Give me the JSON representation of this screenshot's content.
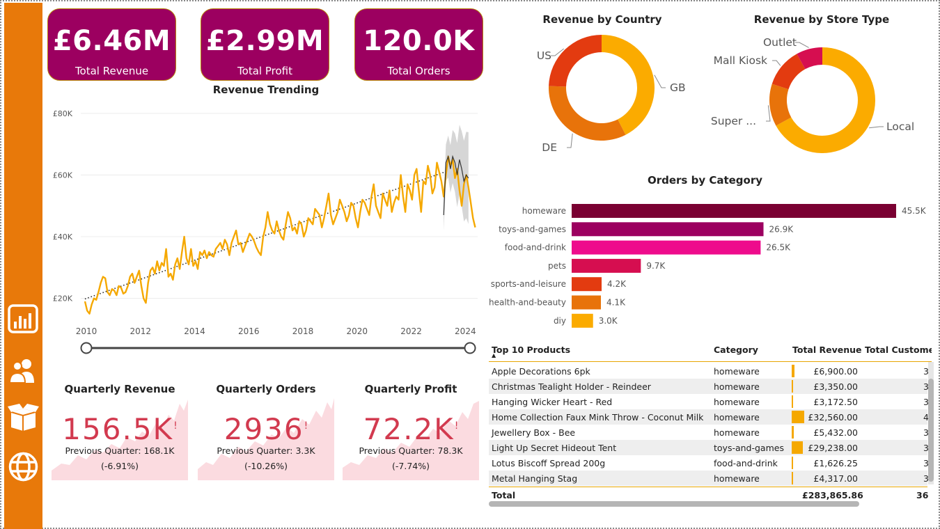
{
  "kpis": [
    {
      "value": "£6.46M",
      "label": "Total Revenue"
    },
    {
      "value": "£2.99M",
      "label": "Total Profit"
    },
    {
      "value": "120.0K",
      "label": "Total Orders"
    }
  ],
  "sidebar": {
    "items": [
      {
        "icon": "bar-chart-icon"
      },
      {
        "icon": "users-icon"
      },
      {
        "icon": "box-icon"
      },
      {
        "icon": "globe-icon"
      }
    ]
  },
  "quarterly": [
    {
      "title": "Quarterly Revenue",
      "value": "156.5K",
      "flag": "!",
      "previous": "Previous Quarter: 168.1K",
      "change": "(-6.91%)"
    },
    {
      "title": "Quarterly Orders",
      "value": "2936",
      "flag": "!",
      "previous": "Previous Quarter: 3.3K",
      "change": "(-10.26%)"
    },
    {
      "title": "Quarterly Profit",
      "value": "72.2K",
      "flag": "!",
      "previous": "Previous Quarter: 78.3K",
      "change": "(-7.74%)"
    }
  ],
  "table": {
    "headers": [
      "Top 10 Products",
      "Category",
      "Total Revenue",
      "Total Customers"
    ],
    "header_display": [
      "Top 10 Products",
      "Category",
      "Total Revenue",
      "Total Custome"
    ],
    "rows": [
      {
        "product": "Apple Decorations 6pk",
        "category": "homeware",
        "revenue": "£6,900.00",
        "revenue_num": 6900,
        "customers": "3"
      },
      {
        "product": "Christmas Tealight Holder - Reindeer",
        "category": "homeware",
        "revenue": "£3,350.00",
        "revenue_num": 3350,
        "customers": "3"
      },
      {
        "product": "Hanging Wicker Heart - Red",
        "category": "homeware",
        "revenue": "£3,172.50",
        "revenue_num": 3172.5,
        "customers": "3"
      },
      {
        "product": "Home Collection Faux Mink Throw - Coconut Milk",
        "category": "homeware",
        "revenue": "£32,560.00",
        "revenue_num": 32560,
        "customers": "4"
      },
      {
        "product": "Jewellery Box - Bee",
        "category": "homeware",
        "revenue": "£5,432.00",
        "revenue_num": 5432,
        "customers": "3"
      },
      {
        "product": "Light Up Secret Hideout Tent",
        "category": "toys-and-games",
        "revenue": "£29,238.00",
        "revenue_num": 29238,
        "customers": "3"
      },
      {
        "product": "Lotus Biscoff Spread 200g",
        "category": "food-and-drink",
        "revenue": "£1,626.25",
        "revenue_num": 1626.25,
        "customers": "3"
      },
      {
        "product": "Metal Hanging Stag",
        "category": "homeware",
        "revenue": "£4,317.00",
        "revenue_num": 4317,
        "customers": "3"
      }
    ],
    "total_label": "Total",
    "total_revenue": "£283,865.86",
    "total_customers": "36"
  },
  "colors": {
    "sidebar": "#e8790a",
    "kpi": "#9c0060",
    "line": "#f5a800",
    "quarter_value": "#d23a4f"
  },
  "chart_data": [
    {
      "type": "line",
      "title": "Revenue Trending",
      "xlabel": "",
      "ylabel": "",
      "xlim": [
        2010,
        2024.3
      ],
      "ylim": [
        12000,
        82000
      ],
      "yticks": [
        20000,
        40000,
        60000,
        80000
      ],
      "ytick_labels": [
        "£20K",
        "£40K",
        "£60K",
        "£80K"
      ],
      "xticks": [
        2010,
        2012,
        2014,
        2016,
        2018,
        2020,
        2022,
        2024
      ],
      "xtick_labels": [
        "2010",
        "2012",
        "2014",
        "2016",
        "2018",
        "2020",
        "2022",
        "2024"
      ],
      "grid": true,
      "series": [
        {
          "values_monthly_from_2010": [
            19000,
            16000,
            15000,
            18000,
            20000,
            19500,
            22000,
            25000,
            27000,
            26500,
            22000,
            21000,
            23000,
            22500,
            21000,
            24000,
            23500,
            21500,
            22000,
            24000,
            27000,
            28000,
            25000,
            27000,
            29000,
            24000,
            20000,
            18500,
            25000,
            29000,
            30000,
            28000,
            32000,
            29000,
            31500,
            30500,
            36000,
            27000,
            28000,
            26000,
            31000,
            33000,
            29500,
            35000,
            40000,
            33000,
            31000,
            36000,
            30500,
            32000,
            29500,
            35000,
            34000,
            35500,
            33000,
            35000,
            34000,
            33500,
            36000,
            37000,
            38000,
            36000,
            39000,
            37500,
            34000,
            38000,
            40000,
            42000,
            37500,
            38000,
            35000,
            37000,
            39000,
            41000,
            40000,
            38500,
            36500,
            35000,
            34000,
            40000,
            43000,
            48000,
            44000,
            42000,
            41000,
            45000,
            42000,
            40000,
            39000,
            44000,
            48000,
            46000,
            42000,
            43000,
            41000,
            45000,
            44000,
            40000,
            42000,
            46000,
            45000,
            44000,
            49000,
            48000,
            47000,
            43000,
            46000,
            50000,
            54000,
            47000,
            44000,
            46000,
            48000,
            52000,
            50000,
            48000,
            45000,
            47000,
            51000,
            50000,
            46000,
            43000,
            48000,
            52000,
            51000,
            49000,
            47000,
            53000,
            57000,
            50000,
            48000,
            46000,
            54000,
            52000,
            50000,
            55000,
            48000,
            51000,
            53000,
            52000,
            60000,
            53000,
            48000,
            57000,
            55000,
            52000,
            60000,
            62000,
            55000,
            48000,
            58000,
            57000,
            63000,
            60000,
            54000,
            56000,
            64000,
            61000,
            58000,
            53000,
            60000,
            66000,
            63000,
            65000,
            59000,
            62000,
            55000,
            50000,
            57000,
            60000,
            56000,
            51000,
            46000,
            43000
          ]
        },
        {
          "values_monthly_from_2023_4": [
            47000,
            64000,
            66000,
            62000,
            66000,
            64000,
            60000,
            65000,
            62000,
            58000,
            60000,
            59000
          ]
        },
        {
          "trend": [
            [
              2010,
              19800
            ],
            [
              2023.3,
              61000
            ]
          ]
        }
      ]
    },
    {
      "type": "pie",
      "title": "Revenue by Country",
      "categories": [
        "GB",
        "DE",
        "US"
      ],
      "values": [
        42.5,
        33,
        24.5
      ],
      "colors": [
        "#fbab00",
        "#e8730a",
        "#e33b10"
      ]
    },
    {
      "type": "pie",
      "title": "Revenue by Store Type",
      "categories": [
        "Local",
        "Super ...",
        "Mall Kiosk",
        "Outlet"
      ],
      "values": [
        67,
        13,
        12,
        8
      ],
      "colors": [
        "#fbab00",
        "#e8730a",
        "#e33b10",
        "#d60e50"
      ]
    },
    {
      "type": "bar",
      "title": "Orders by Category",
      "categories": [
        "homeware",
        "toys-and-games",
        "food-and-drink",
        "pets",
        "sports-and-leisure",
        "health-and-beauty",
        "diy"
      ],
      "values": [
        45500,
        26900,
        26500,
        9700,
        4200,
        4100,
        3000
      ],
      "value_labels": [
        "45.5K",
        "26.9K",
        "26.5K",
        "9.7K",
        "4.2K",
        "4.1K",
        "3.0K"
      ],
      "colors": [
        "#7a0032",
        "#9c0060",
        "#ee0b8c",
        "#d60e50",
        "#e33b10",
        "#e8730a",
        "#fbab00"
      ],
      "xlim": [
        0,
        45500
      ]
    }
  ]
}
